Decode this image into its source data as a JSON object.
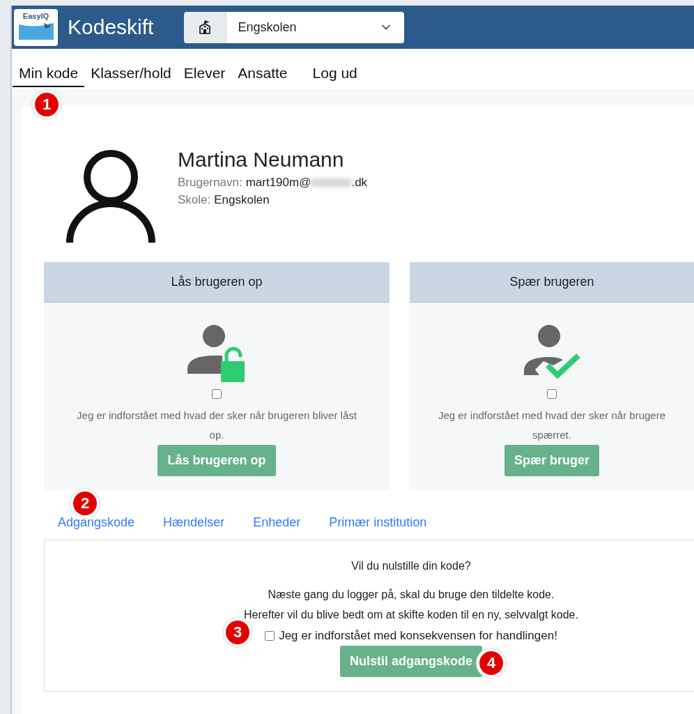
{
  "header": {
    "logo_text": "EasyIQ",
    "title": "Kodeskift",
    "school_select": {
      "value": "Engskolen"
    }
  },
  "nav": {
    "items": [
      {
        "label": "Min kode",
        "selected": true
      },
      {
        "label": "Klasser/hold",
        "selected": false
      },
      {
        "label": "Elever",
        "selected": false
      },
      {
        "label": "Ansatte",
        "selected": false
      }
    ],
    "logout": "Log ud",
    "callout": "1"
  },
  "profile": {
    "name": "Martina Neumann",
    "username_label": "Brugernavn:",
    "username_prefix": "mart190m@",
    "username_suffix": ".dk",
    "school_label": "Skole:",
    "school": "Engskolen"
  },
  "panels": [
    {
      "kind": "unlock",
      "title": "Lås brugeren op",
      "checked": false,
      "text_lines": [
        "Jeg er indforstået med hvad der sker når brugeren bliver låst",
        "op."
      ],
      "button": "Lås brugeren op"
    },
    {
      "kind": "block",
      "title": "Spær brugeren",
      "checked": false,
      "text_lines": [
        "Jeg er indforstået med hvad der sker når brugere",
        "spærret."
      ],
      "button": "Spær bruger"
    }
  ],
  "tabs": {
    "callout": "2",
    "items": [
      "Adgangskode",
      "Hændelser",
      "Enheder",
      "Primær institution"
    ]
  },
  "reset": {
    "question": "Vil du nulstille din kode?",
    "info_lines": [
      "Næste gang du logger på, skal du bruge den tildelte kode.",
      "Herefter vil du blive bedt om at skifte koden til en ny, selvvalgt kode."
    ],
    "confirm_callout": "3",
    "confirm_checked": false,
    "confirm_label": "Jeg er indforstået med konsekvensen for handlingen!",
    "button": "Nulstil adgangskode",
    "button_callout": "4"
  }
}
